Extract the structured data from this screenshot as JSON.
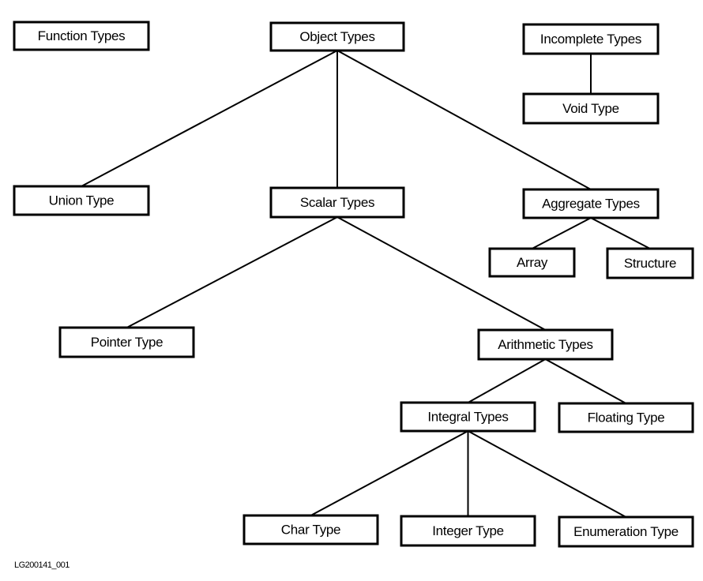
{
  "nodes": [
    {
      "id": "function",
      "label": "Function Types"
    },
    {
      "id": "object",
      "label": "Object Types"
    },
    {
      "id": "incomplete",
      "label": "Incomplete Types"
    },
    {
      "id": "void",
      "label": "Void Type"
    },
    {
      "id": "union",
      "label": "Union Type"
    },
    {
      "id": "scalar",
      "label": "Scalar Types"
    },
    {
      "id": "aggregate",
      "label": "Aggregate Types"
    },
    {
      "id": "array",
      "label": "Array"
    },
    {
      "id": "structure",
      "label": "Structure"
    },
    {
      "id": "pointer",
      "label": "Pointer Type"
    },
    {
      "id": "arithmetic",
      "label": "Arithmetic Types"
    },
    {
      "id": "integral",
      "label": "Integral Types"
    },
    {
      "id": "floating",
      "label": "Floating Type"
    },
    {
      "id": "char",
      "label": "Char Type"
    },
    {
      "id": "integer",
      "label": "Integer Type"
    },
    {
      "id": "enumeration",
      "label": "Enumeration Type"
    }
  ],
  "edges": [
    [
      "object",
      "union"
    ],
    [
      "object",
      "scalar"
    ],
    [
      "object",
      "aggregate"
    ],
    [
      "incomplete",
      "void"
    ],
    [
      "aggregate",
      "array"
    ],
    [
      "aggregate",
      "structure"
    ],
    [
      "scalar",
      "pointer"
    ],
    [
      "scalar",
      "arithmetic"
    ],
    [
      "arithmetic",
      "integral"
    ],
    [
      "arithmetic",
      "floating"
    ],
    [
      "integral",
      "char"
    ],
    [
      "integral",
      "integer"
    ],
    [
      "integral",
      "enumeration"
    ]
  ],
  "figure_id": "LG200141_001"
}
